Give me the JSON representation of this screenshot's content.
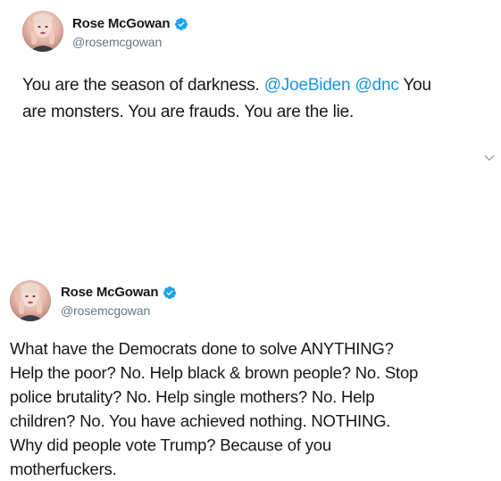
{
  "tweets": [
    {
      "author": {
        "name": "Rose McGowan",
        "handle": "@rosemcgowan",
        "verified": true
      },
      "text_lines": [
        [
          {
            "text": "You are the season of darkness.  ",
            "type": "text"
          },
          {
            "text": "@JoeBiden",
            "type": "mention"
          },
          {
            "text": " ",
            "type": "text"
          },
          {
            "text": "@dnc",
            "type": "mention"
          },
          {
            "text": " You",
            "type": "text"
          }
        ],
        [
          {
            "text": "are monsters. You are frauds. You are the lie.",
            "type": "text"
          }
        ]
      ]
    },
    {
      "author": {
        "name": "Rose McGowan",
        "handle": "@rosemcgowan",
        "verified": true
      },
      "text_lines": [
        "What have the Democrats done to solve ANYTHING?",
        "Help the poor? No. Help black & brown people? No. Stop",
        "police brutality? No. Help single mothers? No. Help",
        "children? No. You have achieved nothing. NOTHING.",
        "Why did people vote Trump? Because of you",
        "motherfuckers."
      ]
    }
  ],
  "colors": {
    "text": "#14171a",
    "secondary": "#657786",
    "link": "#1b95e0",
    "verified": "#1da1f2"
  },
  "icons": {
    "verified": "verified-badge-icon",
    "menu": "chevron-down-icon",
    "avatar": "profile-photo"
  }
}
